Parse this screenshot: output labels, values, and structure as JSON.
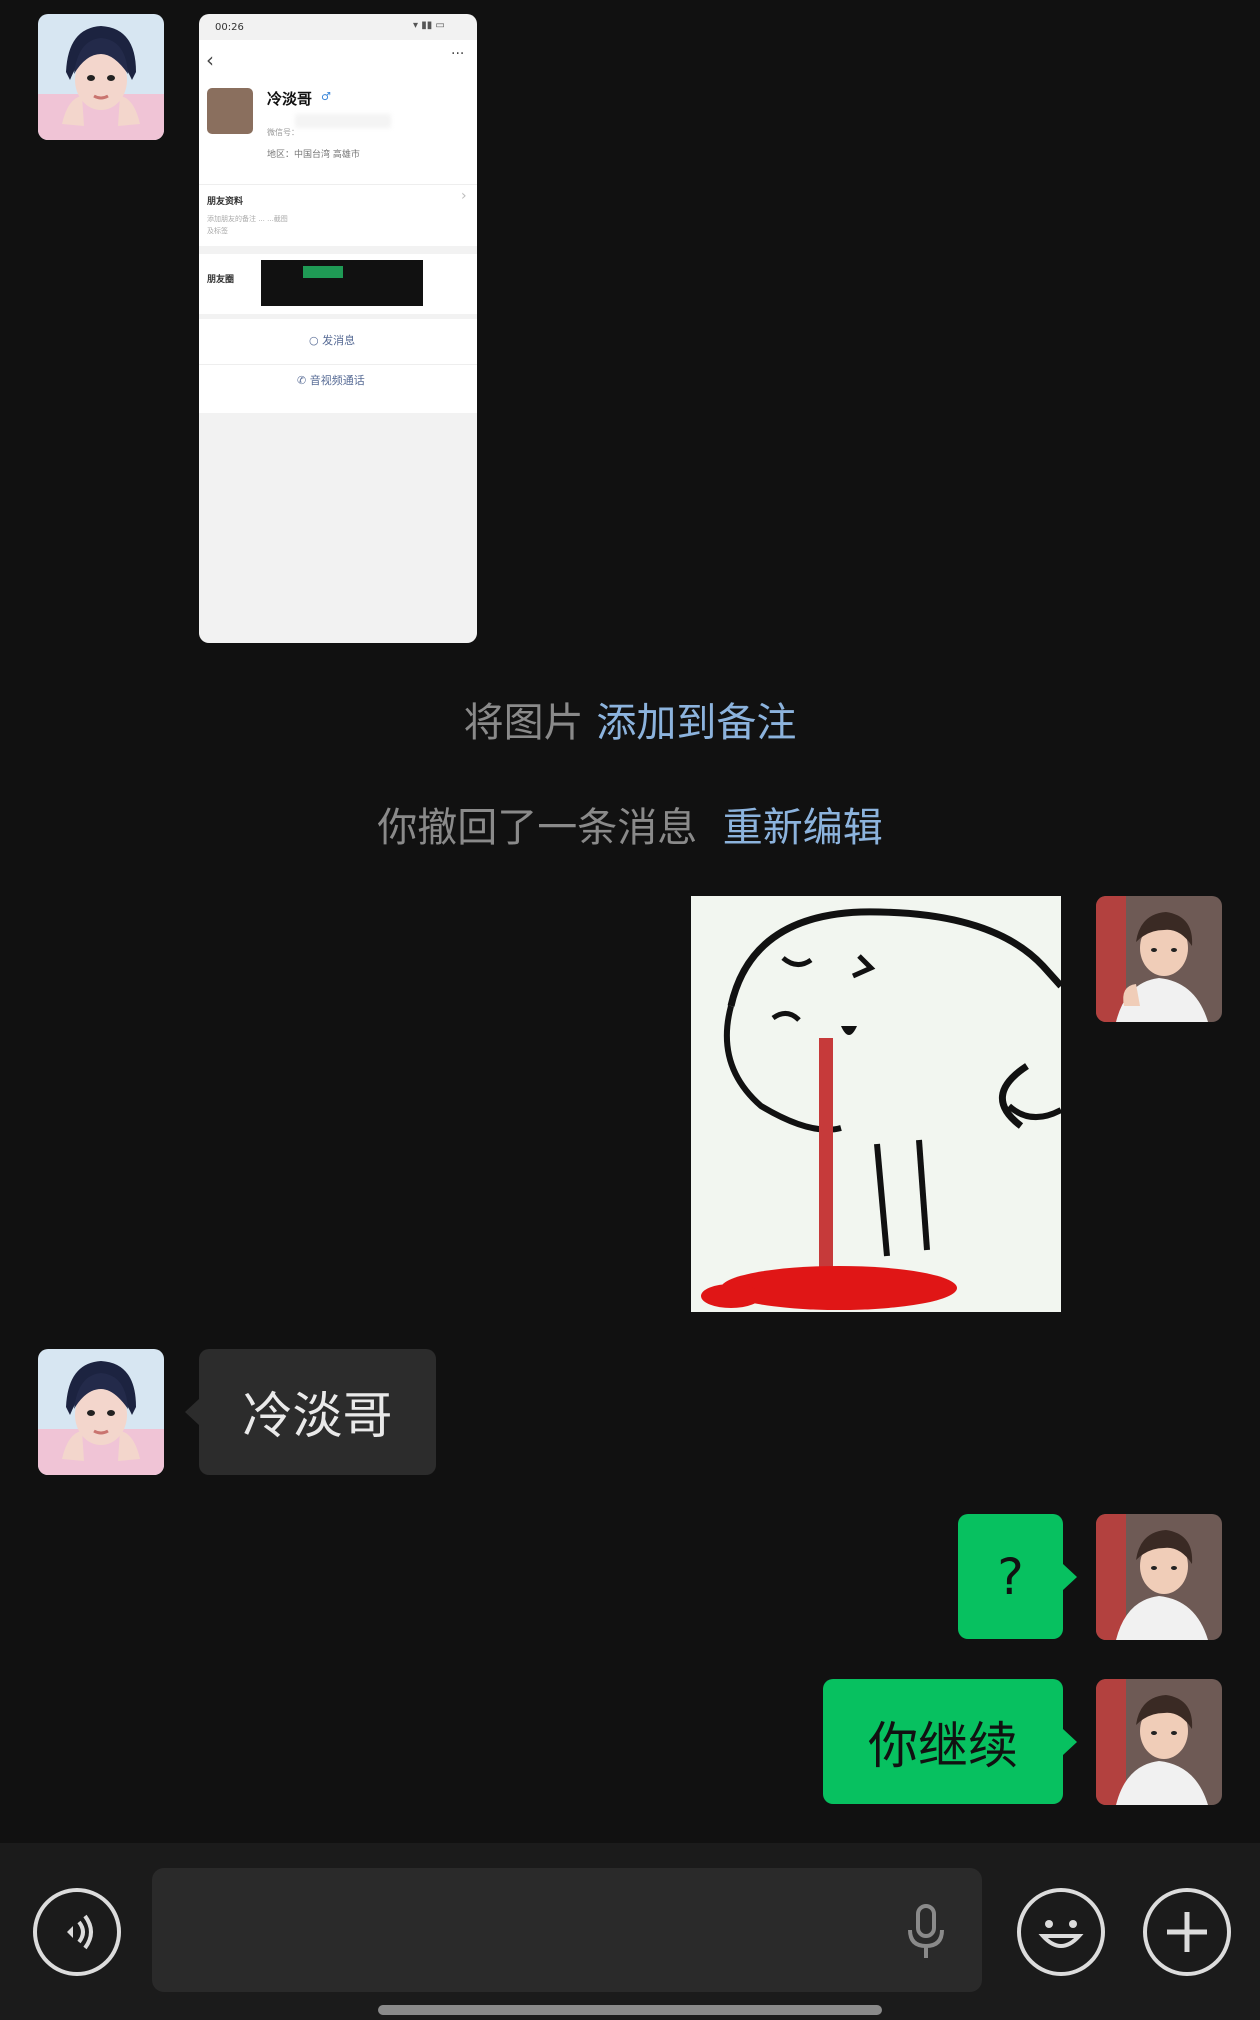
{
  "contact": {
    "name": "冷淡哥"
  },
  "shot": {
    "time": "00:26",
    "back": "‹",
    "more": "···",
    "nickname": "冷淡哥",
    "gender": "♂",
    "id_line": "微信号：",
    "region": "地区：中国台湾 高雄市",
    "section_title": "朋友资料",
    "section_arrow": "›",
    "section_sub": "添加朋友的备注 ...                 ...截图",
    "section_sub2": "及标签",
    "friends_label": "朋友圈",
    "send_msg": "发消息",
    "call": "音视频通话"
  },
  "system": {
    "note_prefix": "将图片",
    "note_link": "添加到备注",
    "recall_text": "你撤回了一条消息",
    "recall_link": "重新编辑"
  },
  "messages": {
    "incoming_text": "冷淡哥",
    "out_question": "?",
    "out_continue": "你继续"
  },
  "colors": {
    "background": "#111111",
    "bubble_out": "#07c160",
    "bubble_in": "#2c2c2c",
    "link": "#8cb3dd"
  },
  "icons": [
    "voice-mode-icon",
    "mic-icon",
    "emoji-icon",
    "plus-icon"
  ]
}
